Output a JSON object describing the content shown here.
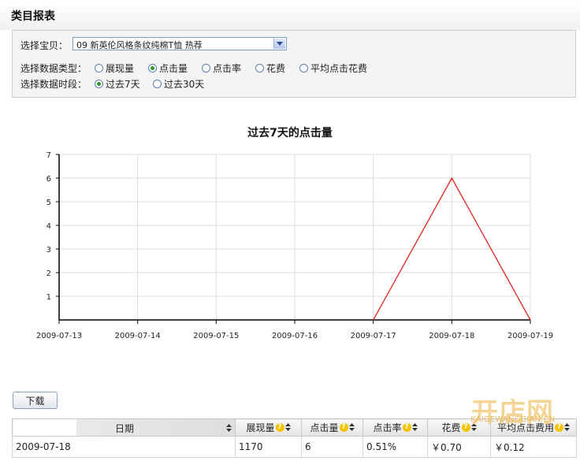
{
  "page": {
    "title": "类目报表"
  },
  "filters": {
    "item_label": "选择宝贝：",
    "item_value": "09 新英伦风格条纹纯棉T恤 热荐",
    "type_label": "选择数据类型：",
    "type_options": [
      {
        "label": "展现量",
        "checked": false
      },
      {
        "label": "点击量",
        "checked": true
      },
      {
        "label": "点击率",
        "checked": false
      },
      {
        "label": "花费",
        "checked": false
      },
      {
        "label": "平均点击花费",
        "checked": false
      }
    ],
    "period_label": "选择数据时段：",
    "period_options": [
      {
        "label": "过去7天",
        "checked": true
      },
      {
        "label": "过去30天",
        "checked": false
      }
    ]
  },
  "chart_data": {
    "type": "line",
    "title": "过去7天的点击量",
    "x": [
      "2009-07-13",
      "2009-07-14",
      "2009-07-15",
      "2009-07-16",
      "2009-07-17",
      "2009-07-18",
      "2009-07-19"
    ],
    "series": [
      {
        "values": [
          null,
          null,
          null,
          null,
          0,
          6,
          0
        ],
        "color": "#e8231e"
      }
    ],
    "yticks": [
      1,
      2,
      3,
      4,
      5,
      6,
      7
    ],
    "ylim": [
      0,
      7
    ],
    "grid": true,
    "legend": "none"
  },
  "actions": {
    "download_label": "下载"
  },
  "table": {
    "columns": [
      {
        "label": "日期",
        "help": false
      },
      {
        "label": "展现量",
        "help": true
      },
      {
        "label": "点击量",
        "help": true
      },
      {
        "label": "点击率",
        "help": true
      },
      {
        "label": "花费",
        "help": true
      },
      {
        "label": "平均点击费用",
        "help": true
      }
    ],
    "rows": [
      [
        "2009-07-18",
        "1170",
        "6",
        "0.51%",
        "￥0.70",
        "￥0.12"
      ]
    ]
  },
  "watermark": {
    "logo": "开店网",
    "url": "KAIGEWANGDIAN.CN"
  },
  "colors": {
    "line": "#e8231e",
    "radio_dot": "#2a9b2a",
    "help_icon": "#f5c400"
  }
}
